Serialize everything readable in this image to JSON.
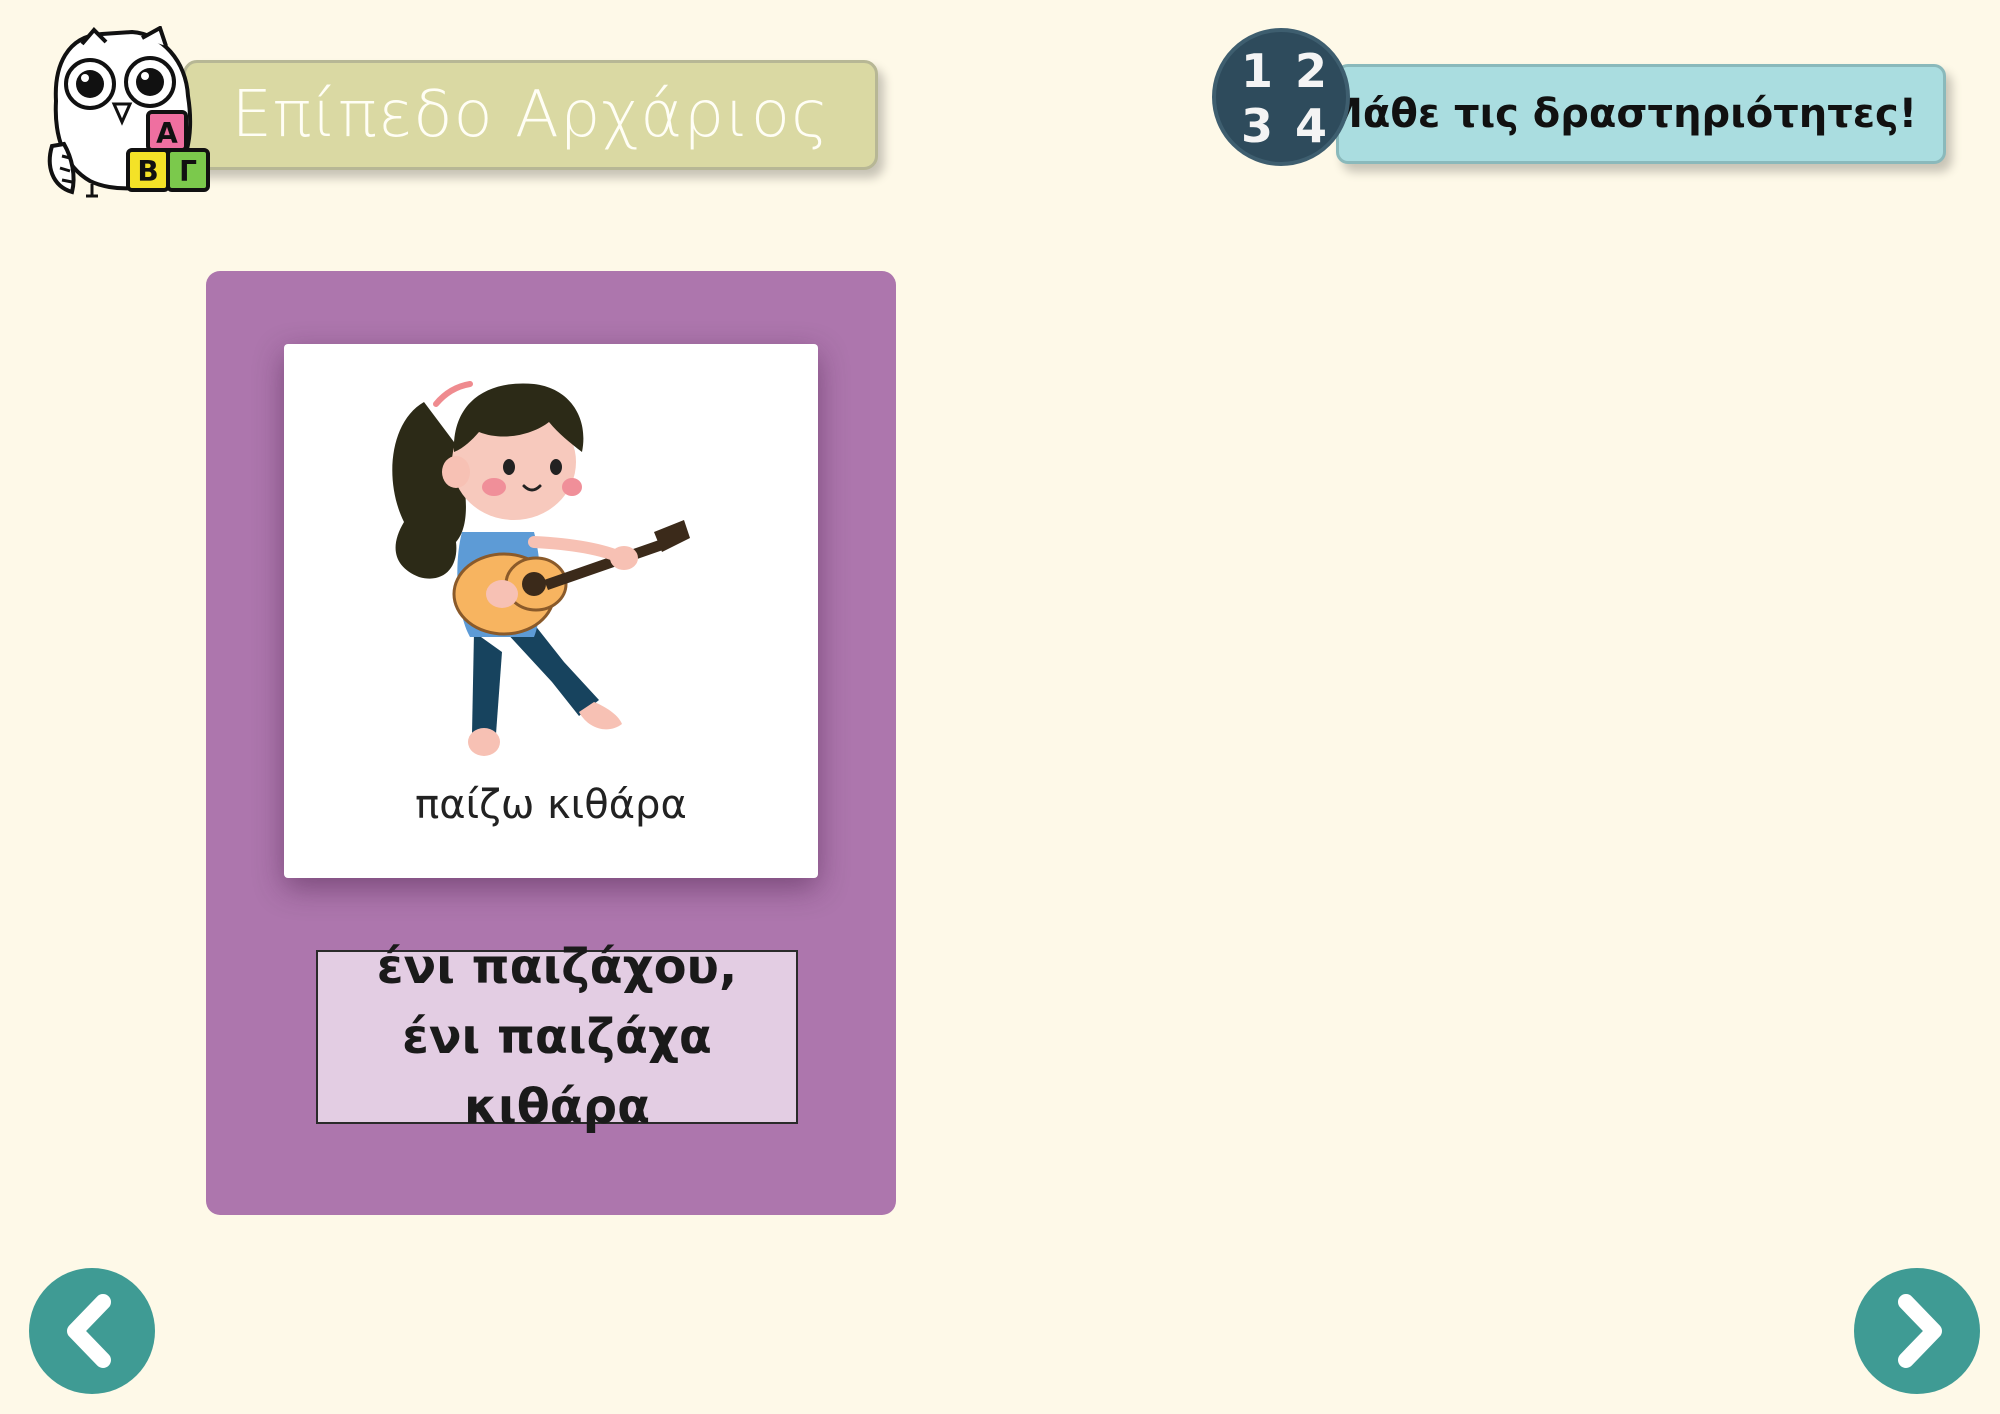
{
  "header": {
    "level_title": "Επίπεδο Αρχάριος",
    "logo_letters": [
      "Α",
      "Β",
      "Γ"
    ],
    "instruction": "Μάθε τις δραστηριότητες!",
    "badge_numbers": [
      "1",
      "2",
      "3",
      "4"
    ]
  },
  "card": {
    "image_icon": "girl-playing-guitar-icon",
    "caption": "παίζω κιθάρα",
    "dialect_text": "ένι παιζάχου, ένι παιζάχα κιθάρα"
  },
  "nav": {
    "prev_icon": "chevron-left-icon",
    "next_icon": "chevron-right-icon"
  },
  "colors": {
    "background": "#fef9e8",
    "level_banner": "#dad9a3",
    "instruction_banner": "#aadde0",
    "badge": "#2e4b5c",
    "card": "#ad76ad",
    "dialect_box": "#e3cde3",
    "nav_button": "#3f9b94"
  }
}
